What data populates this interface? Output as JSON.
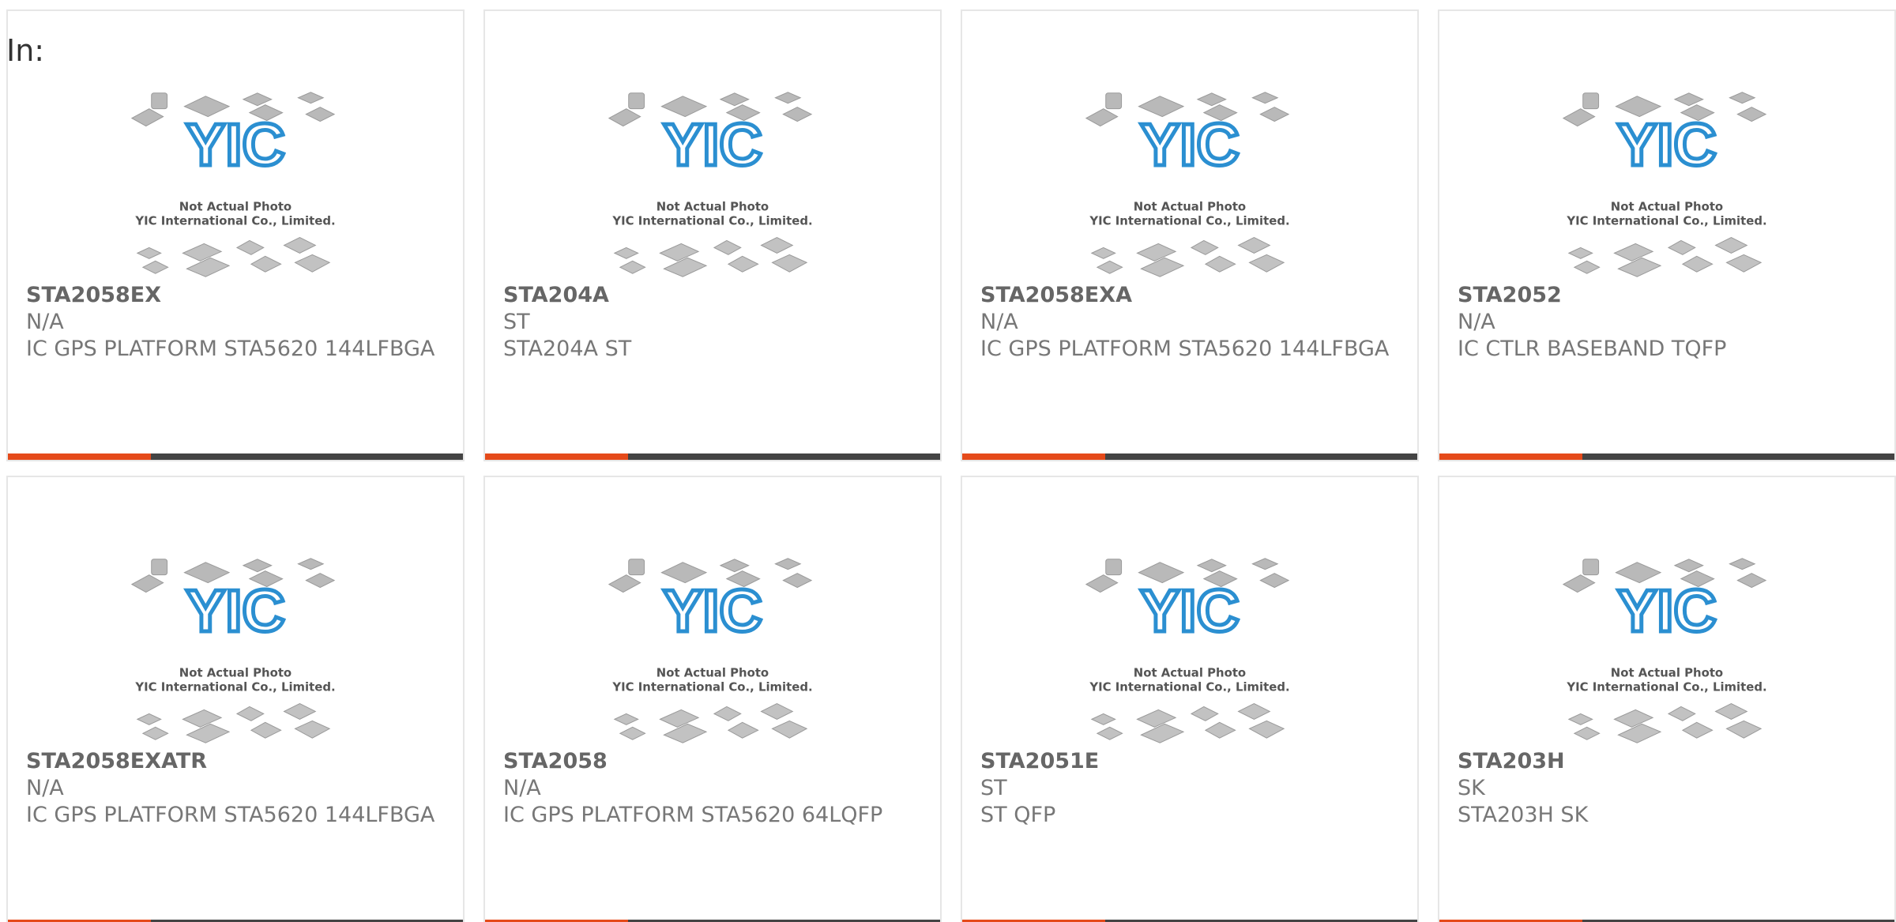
{
  "intro": "In:",
  "colors": {
    "accent": "#e54a1a",
    "bar": "#444444",
    "logo": "#2b8fd1"
  },
  "placeholder": {
    "logo": "YIC",
    "caption_line1": "Not Actual Photo",
    "caption_line2": "YIC International Co., Limited."
  },
  "products": [
    {
      "part": "STA2058EX",
      "maker": "N/A",
      "desc": "IC GPS PLATFORM STA5620 144LFBGA"
    },
    {
      "part": "STA204A",
      "maker": "ST",
      "desc": "STA204A ST"
    },
    {
      "part": "STA2058EXA",
      "maker": "N/A",
      "desc": "IC GPS PLATFORM STA5620 144LFBGA"
    },
    {
      "part": "STA2052",
      "maker": "N/A",
      "desc": "IC CTLR BASEBAND TQFP"
    },
    {
      "part": "STA2058EXATR",
      "maker": "N/A",
      "desc": "IC GPS PLATFORM STA5620 144LFBGA"
    },
    {
      "part": "STA2058",
      "maker": "N/A",
      "desc": "IC GPS PLATFORM STA5620 64LQFP"
    },
    {
      "part": "STA2051E",
      "maker": "ST",
      "desc": "ST QFP"
    },
    {
      "part": "STA203H",
      "maker": "SK",
      "desc": "STA203H SK"
    }
  ]
}
